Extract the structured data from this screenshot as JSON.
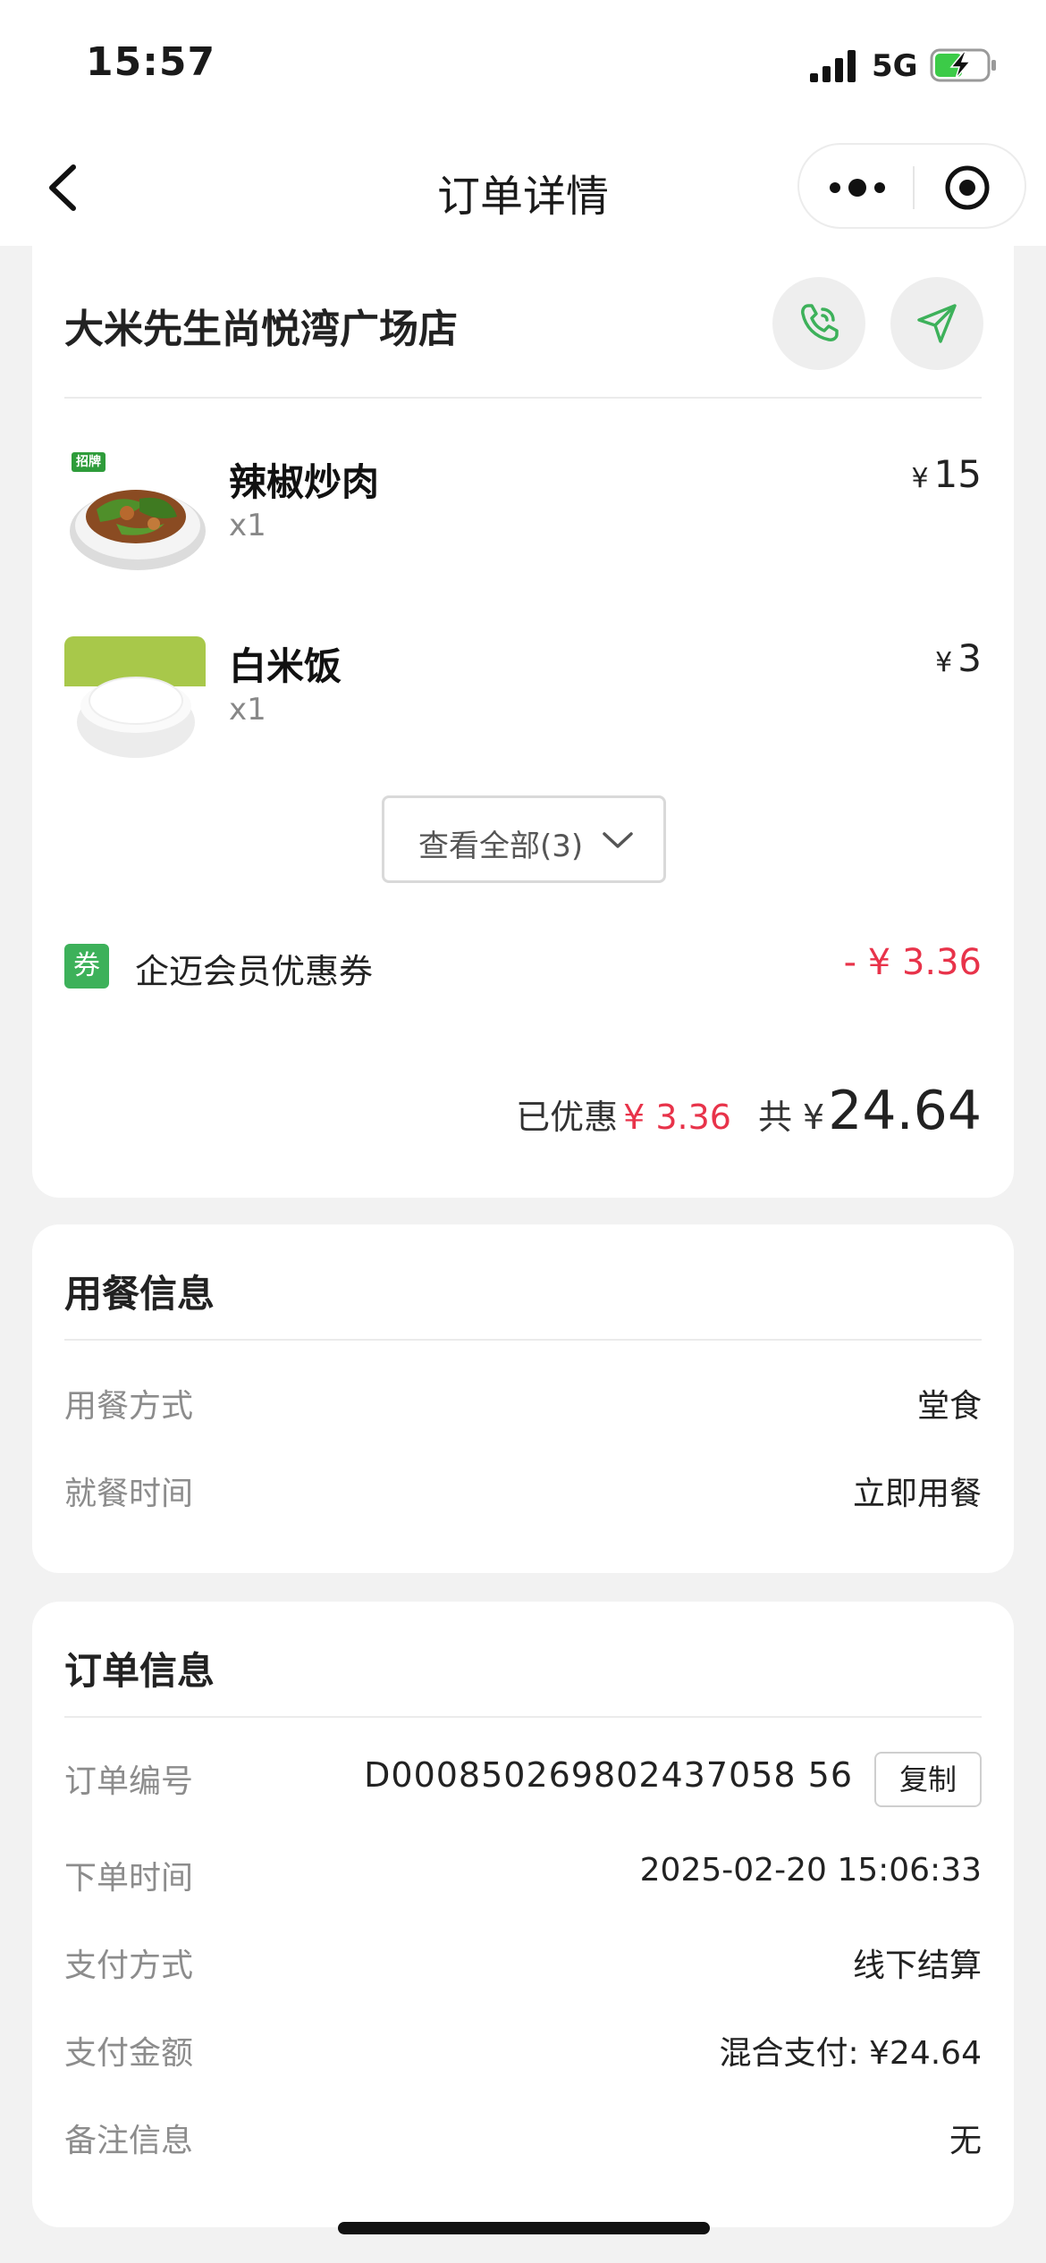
{
  "status_bar": {
    "time": "15:57",
    "network": "5G"
  },
  "nav": {
    "title": "订单详情"
  },
  "store": {
    "name": "大米先生尚悦湾广场店"
  },
  "items": [
    {
      "name": "辣椒炒肉",
      "qty": "x1",
      "currency": "¥",
      "price": "15",
      "badge": "招牌"
    },
    {
      "name": "白米饭",
      "qty": "x1",
      "currency": "¥",
      "price": "3"
    }
  ],
  "view_all_label": "查看全部(3)",
  "coupon": {
    "badge": "券",
    "name": "企迈会员优惠券",
    "amount": "- ¥ 3.36"
  },
  "totals": {
    "discount_label": "已优惠",
    "discount_value": "¥ 3.36",
    "total_label": "共 ¥",
    "total_value": "24.64"
  },
  "dining": {
    "title": "用餐信息",
    "rows": [
      {
        "label": "用餐方式",
        "value": "堂食"
      },
      {
        "label": "就餐时间",
        "value": "立即用餐"
      }
    ]
  },
  "order_info": {
    "title": "订单信息",
    "order_no_label": "订单编号",
    "order_no": "D000850269802437058 56",
    "copy_label": "复制",
    "rows": [
      {
        "label": "下单时间",
        "value": "2025-02-20 15:06:33"
      },
      {
        "label": "支付方式",
        "value": "线下结算"
      },
      {
        "label": "支付金额",
        "value": "混合支付: ¥24.64"
      },
      {
        "label": "备注信息",
        "value": "无"
      }
    ]
  },
  "colors": {
    "accent_green": "#3db15a",
    "discount_red": "#e8334a"
  }
}
